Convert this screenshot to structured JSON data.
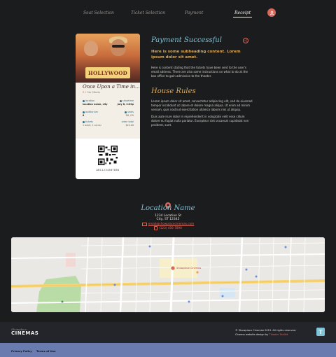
{
  "nav": {
    "items": [
      "Seat Selection",
      "Ticket Selection",
      "Payment",
      "Receipt"
    ],
    "active_index": 3,
    "button_icon": "user-icon"
  },
  "ticket": {
    "poster_text": "HOLLYWOOD",
    "movie_title": "Once Upon a Time in...",
    "rating": "R",
    "runtime": "1hr 10min",
    "location_label": "location",
    "location_value": "location name, city",
    "showtime_label": "showtime",
    "showtime_value": "July 8, 2:00p",
    "auditorium_label": "auditorium",
    "auditorium_value": "8",
    "seats_label": "seats",
    "seats_value": "D8, D9",
    "tickets_label": "tickets",
    "tickets_value": "1 adult, 1 senior",
    "order_total_label": "order total",
    "order_total_value": "$20.00",
    "code": "ABC1234567890"
  },
  "payment": {
    "title": "Payment Successful",
    "subheading": "Here is some subheading content. Lorem ipsum dolor sit amet.",
    "body": "Here is content stating that the tickets have been sent to the user's email address. There are also some instructions on what to do at the box office to gain admission to the theater.",
    "share_icon": "share-icon"
  },
  "house_rules": {
    "title": "House Rules",
    "p1": "Lorem ipsum dolor sit amet, consectetur adipiscing elit, sed do eiusmod tempor incididunt ut labore et dolore magna aliqua. Ut enim ad minim veniam, quis nostrud exercitation ullamco laboris nisi ut aliquip.",
    "p2": "Duis aute irure dolor in reprehenderit in voluptate velit esse cillum dolore eu fugiat nulla pariatur. Excepteur sint occaecat cupidatat non proident, sunt."
  },
  "location": {
    "title": "Location Name",
    "address1": "1234 Location St",
    "address2": "City, ST 12345",
    "email": "email@showplacecinemas.com",
    "phone": "(123) 456-7890",
    "map_label": "Showplace Cinemas"
  },
  "footer": {
    "brand_small": "Showplace",
    "brand_big": "CINEMAS",
    "copyright": "© Showplace Cinemas 2019. All rights reserved.",
    "design_prefix": "Cinema website design by",
    "design_by": "Theater Toolkit.",
    "badge": "T",
    "links": [
      "Privacy Policy",
      "Terms of Use"
    ]
  },
  "colors": {
    "background": "#1b1c1e",
    "accent": "#d9675a",
    "teal": "#7fc3d8",
    "gold": "#d6a85f",
    "footer_bar": "#6a7bb0"
  }
}
